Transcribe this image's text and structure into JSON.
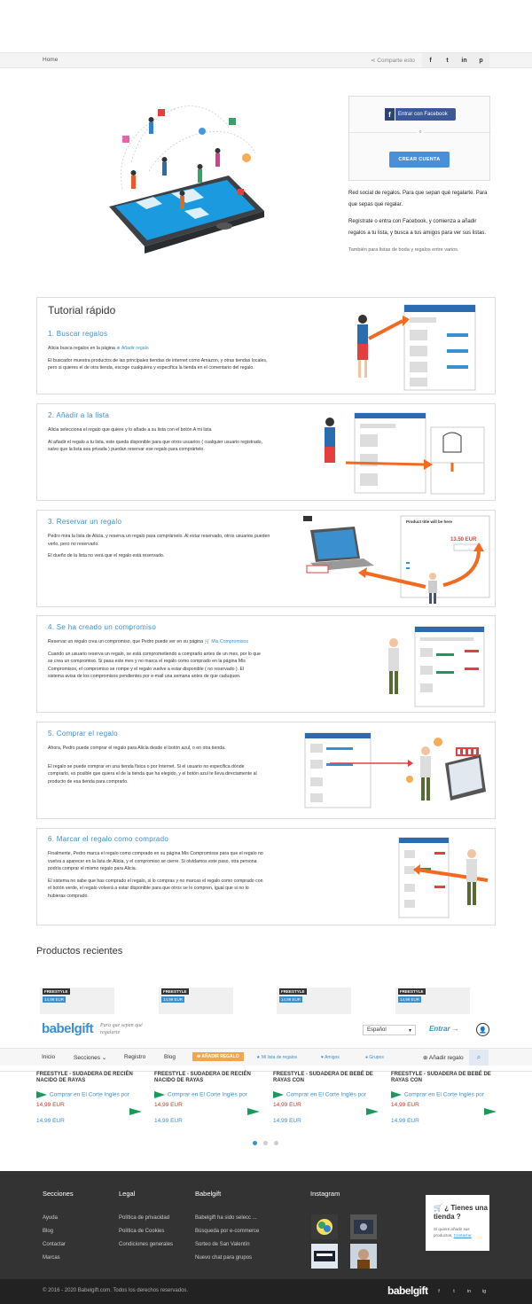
{
  "breadcrumb": {
    "home": "Home",
    "share": "Comparte esto"
  },
  "top_social": [
    "f",
    "t",
    "in",
    "p"
  ],
  "login": {
    "facebook": "Entrar con Facebook",
    "or": "o",
    "create": "CREAR CUENTA"
  },
  "hero_text": {
    "p1": "Red social de regalos. Para que sepan qué regalarte. Para que sepas qué regalar.",
    "p2": "Regístrate o entra con Facebook, y comienza a añadir regalos a tu lista, y busca a tus amigos para ver sus listas.",
    "p3": "También para listas de boda y regalos entre varios."
  },
  "tutorial": {
    "title": "Tutorial rápido",
    "steps": [
      {
        "title": "1. Buscar regalos",
        "p1": "Alicia busca regalos en la página",
        "p1_link": "Añadir regalo",
        "p2": "El buscador muestra productos de las principales tiendas de internet como Amazon, y otras tiendas locales, pero si quieres el de otra tienda, escoge cualquiera y especifica la tienda en el comentario del regalo."
      },
      {
        "title": "2. Añadir a la lista",
        "p1": "Alicia selecciona el regalo que quiere y lo añade a su lista con el botón A mi lista",
        "p2": "Al añadir el regalo a tu lista, este queda disponible para que otros usuarios ( cualquier usuario registrado, salvo que la lista sea privada ) puedan reservar ese regalo para comprártelo."
      },
      {
        "title": "3. Reservar un regalo",
        "p1": "Pedro mira la lista de Alicia, y reserva un regalo para comprárselo. Al estar reservado, otros usuarios pueden verlo, pero no reservarlo.",
        "p2": "El dueño de la lista no verá que el regalo está reservado."
      },
      {
        "title": "4. Se ha creado un compromiso",
        "p1": "Reservar un regalo crea un compromiso, que Pedro puede ver en su página",
        "p1_link": "Mis Compromisos",
        "p2": "Cuando un usuario reserva un regalo, se está comprometiendo a comprarlo antes de un mes, por lo que se crea un compromiso. Si pasa este mes y no marca el regalo como comprado en la página Mis Compromisos, el compromiso se rompe y el regalo vuelve a estar disponible ( no reservado ). El sistema avisa de los compromisos pendientes por e-mail una semana antes de que caduquen."
      },
      {
        "title": "5. Comprar el regalo",
        "p1": "Ahora, Pedro puede comprar el regalo para Alicia desde el botón azul, o en otra tienda.",
        "p2": "El regalo se puede comprar en una tienda física o por Internet. Si el usuario no especifica dónde comprarlo, es posible que quiera el de la tienda que ha elegido, y el botón azul te lleva directamente al producto de esa tienda para comprarlo."
      },
      {
        "title": "6. Marcar el regalo como comprado",
        "p1": "Finalmente, Pedro marca el regalo como comprado en su página Mis Compromisos para que el regalo no vuelva a aparecer en la lista de Alicia, y el compromiso se cierre. Si olvidamos este paso, otra persona podría comprar el mismo regalo para Alicia.",
        "p2": "El sistema no sabe que has comprado el regalo, si lo compras y no marcas el regalo como comprado con el botón verde, el regalo volverá a estar disponible para que otros se lo compren, igual que si no lo hubieras comprado."
      }
    ]
  },
  "recent": {
    "title": "Productos recientes",
    "badge": "FREESTYLE",
    "products": [
      {
        "name": "FREESTYLE - SUDADERA DE RECIÉN NACIDO DE RAYAS",
        "shop": "Comprar en El Corte Inglés por",
        "price": "14,99 EUR",
        "price2": "14,99 EUR",
        "thumb_price": "14,99 EUR"
      },
      {
        "name": "FREESTYLE - SUDADERA DE RECIÉN NACIDO DE RAYAS",
        "shop": "Comprar en El Corte Inglés por",
        "price": "14,99 EUR",
        "price2": "14,99 EUR",
        "thumb_price": "14,99 EUR"
      },
      {
        "name": "FREESTYLE - SUDADERA DE BEBÉ DE RAYAS CON",
        "shop": "Comprar en El Corte Inglés por",
        "price": "14,99 EUR",
        "price2": "14,99 EUR",
        "thumb_price": "14,99 EUR"
      },
      {
        "name": "FREESTYLE - SUDADERA DE BEBÉ DE RAYAS CON",
        "shop": "Comprar en El Corte Inglés por",
        "price": "14,99 EUR",
        "price2": "14,99 EUR",
        "thumb_price": "14,99 EUR"
      }
    ]
  },
  "header": {
    "logo": "babelgift",
    "tagline": "Para que sepan qué regalarte",
    "language": "Español",
    "login": "Entrar",
    "nav": {
      "inicio": "Inicio",
      "secciones": "Secciones",
      "registro": "Registro",
      "blog": "Blog",
      "add_gift": "AÑADIR REGALO",
      "my_list": "Mi lista de regalos",
      "friends": "Amigos",
      "groups": "Grupos",
      "add_gift2": "Añadir regalo"
    }
  },
  "footer": {
    "cols": [
      {
        "title": "Secciones",
        "items": [
          "Ayuda",
          "Blog",
          "Contactar",
          "Marcas"
        ]
      },
      {
        "title": "Legal",
        "items": [
          "Política de privacidad",
          "Política de Cookies",
          "Condiciones generales"
        ]
      },
      {
        "title": "Babelgift",
        "items": [
          "Babelgift ha sido selecc ...",
          "Búsqueda por e-commerce",
          "Sorteo de San Valentín",
          "Nuevo chat para grupos"
        ]
      },
      {
        "title": "Instagram",
        "items": []
      }
    ],
    "shop_card": {
      "title": "¿ Tienes una tienda ?",
      "text": "Si quiere añadir sus productos,",
      "link": "Contactar"
    },
    "copyright": "© 2016 - 2020 Babelgift.com. Todos los derechos reservados.",
    "logo": "babelgift",
    "social": [
      "f",
      "t",
      "in",
      "ig"
    ]
  },
  "colors": {
    "accent": "#3a8fce",
    "facebook": "#3b5998",
    "orange": "#f0a64c",
    "green": "#1a9a5a",
    "footer": "#333333"
  }
}
